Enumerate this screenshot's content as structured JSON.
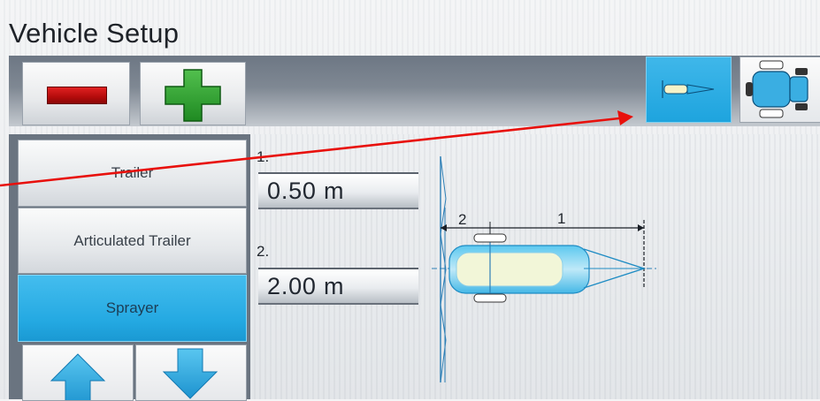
{
  "window": {
    "title": "Vehicle Setup"
  },
  "toolbar": {
    "remove_icon": "minus-icon",
    "add_icon": "plus-icon",
    "view_top_icon": "sprayer-top-view-icon",
    "view_tractor_icon": "tractor-top-view-icon"
  },
  "sidebar": {
    "items": [
      {
        "label": "Trailer",
        "selected": false
      },
      {
        "label": "Articulated Trailer",
        "selected": false
      },
      {
        "label": "Sprayer",
        "selected": true
      }
    ],
    "nav_icons": [
      "arrow-up-icon",
      "arrow-down-icon"
    ]
  },
  "fields": [
    {
      "label": "1.",
      "value": "0.50 m"
    },
    {
      "label": "2.",
      "value": "2.00 m"
    }
  ],
  "diagram": {
    "dimension_labels": [
      "2",
      "1"
    ]
  },
  "colors": {
    "accent": "#24a9e2",
    "remove": "#c41414",
    "add": "#2fa12f",
    "annotation_arrow": "#e8100c"
  }
}
